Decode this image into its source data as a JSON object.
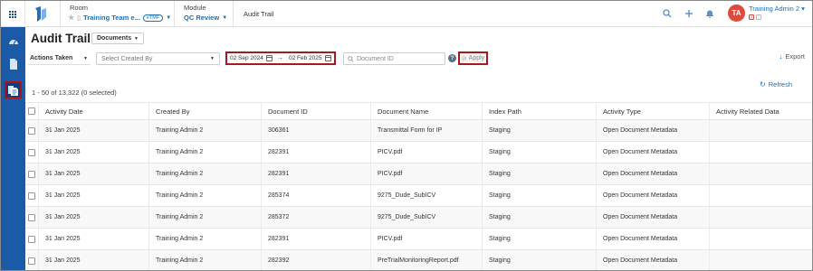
{
  "header": {
    "room_label": "Room",
    "room_value": "Training Team e...",
    "room_badge": "eTMF",
    "module_label": "Module",
    "module_value": "QC Review",
    "current_page": "Audit Trail",
    "user_initials": "TA",
    "user_name": "Training Admin 2 ▾",
    "accent_color": "#1d6fb8",
    "avatar_color": "#e04a3c"
  },
  "sidebar": {
    "items": [
      {
        "icon": "dashboard-icon"
      },
      {
        "icon": "document-icon"
      },
      {
        "icon": "audit-document-icon",
        "active": true
      }
    ],
    "bg_color": "#1a5aa6"
  },
  "page": {
    "title": "Audit Trail",
    "scope_select": "Documents"
  },
  "filters": {
    "actions_taken": "Actions Taken",
    "created_by_placeholder": "Select Created By",
    "date_from": "02 Sep 2024",
    "date_to": "02 Feb 2025",
    "date_separator": "→",
    "document_id_placeholder": "Document ID",
    "help": "?",
    "apply_label": "Apply",
    "export_label": "Export"
  },
  "results": {
    "count_text": "1 - 50 of 13,322 (0 selected)",
    "refresh_label": "Refresh"
  },
  "table": {
    "columns": [
      "Activity Date",
      "Created By",
      "Document ID",
      "Document Name",
      "Index Path",
      "Activity Type",
      "Activity Related Data"
    ],
    "rows": [
      [
        "31 Jan 2025",
        "Training Admin 2",
        "306361",
        "Transmittal Form for IP",
        "Staging",
        "Open Document Metadata",
        ""
      ],
      [
        "31 Jan 2025",
        "Training Admin 2",
        "282391",
        "PICV.pdf",
        "Staging",
        "Open Document Metadata",
        ""
      ],
      [
        "31 Jan 2025",
        "Training Admin 2",
        "282391",
        "PICV.pdf",
        "Staging",
        "Open Document Metadata",
        ""
      ],
      [
        "31 Jan 2025",
        "Training Admin 2",
        "285374",
        "9275_Dude_SubICV",
        "Staging",
        "Open Document Metadata",
        ""
      ],
      [
        "31 Jan 2025",
        "Training Admin 2",
        "285372",
        "9275_Dude_SubICV",
        "Staging",
        "Open Document Metadata",
        ""
      ],
      [
        "31 Jan 2025",
        "Training Admin 2",
        "282391",
        "PICV.pdf",
        "Staging",
        "Open Document Metadata",
        ""
      ],
      [
        "31 Jan 2025",
        "Training Admin 2",
        "282392",
        "PreTrialMonitoringReport.pdf",
        "Staging",
        "Open Document Metadata",
        ""
      ]
    ]
  }
}
